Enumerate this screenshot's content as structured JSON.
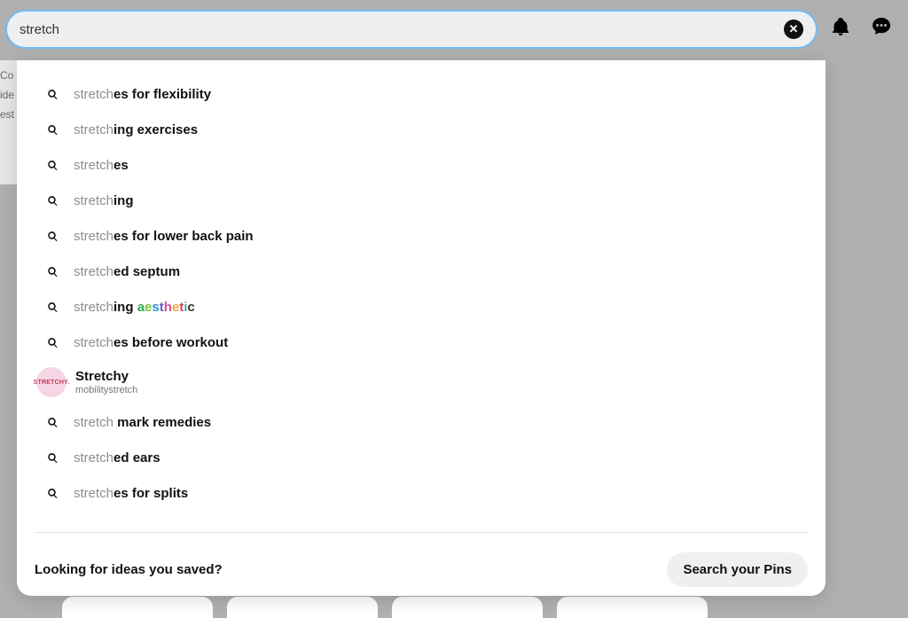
{
  "search": {
    "value": "stretch",
    "clear_label": "✕"
  },
  "suggestions": [
    {
      "prefix": "stretch",
      "suffix": "es for flexibility",
      "aesthetic": false
    },
    {
      "prefix": "stretch",
      "suffix": "ing exercises",
      "aesthetic": false
    },
    {
      "prefix": "stretch",
      "suffix": "es",
      "aesthetic": false
    },
    {
      "prefix": "stretch",
      "suffix": "ing",
      "aesthetic": false
    },
    {
      "prefix": "stretch",
      "suffix": "es for lower back pain",
      "aesthetic": false
    },
    {
      "prefix": "stretch",
      "suffix": "ed septum",
      "aesthetic": false
    },
    {
      "prefix": "stretch",
      "suffix": "ing ",
      "aesthetic": true,
      "aesthetic_word": "aesthetic"
    },
    {
      "prefix": "stretch",
      "suffix": "es before workout",
      "aesthetic": false
    }
  ],
  "profile_suggestion": {
    "name": "Stretchy",
    "handle": "mobilitystretch",
    "avatar_text": "STRETCHY."
  },
  "suggestions_after": [
    {
      "prefix": "stretch",
      "suffix": " mark remedies"
    },
    {
      "prefix": "stretch",
      "suffix": "ed ears"
    },
    {
      "prefix": "stretch",
      "suffix": "es for splits"
    }
  ],
  "footer": {
    "prompt": "Looking for ideas you saved?",
    "button": "Search your Pins"
  },
  "bg_text_lines": [
    "Co",
    "ide",
    "est"
  ]
}
